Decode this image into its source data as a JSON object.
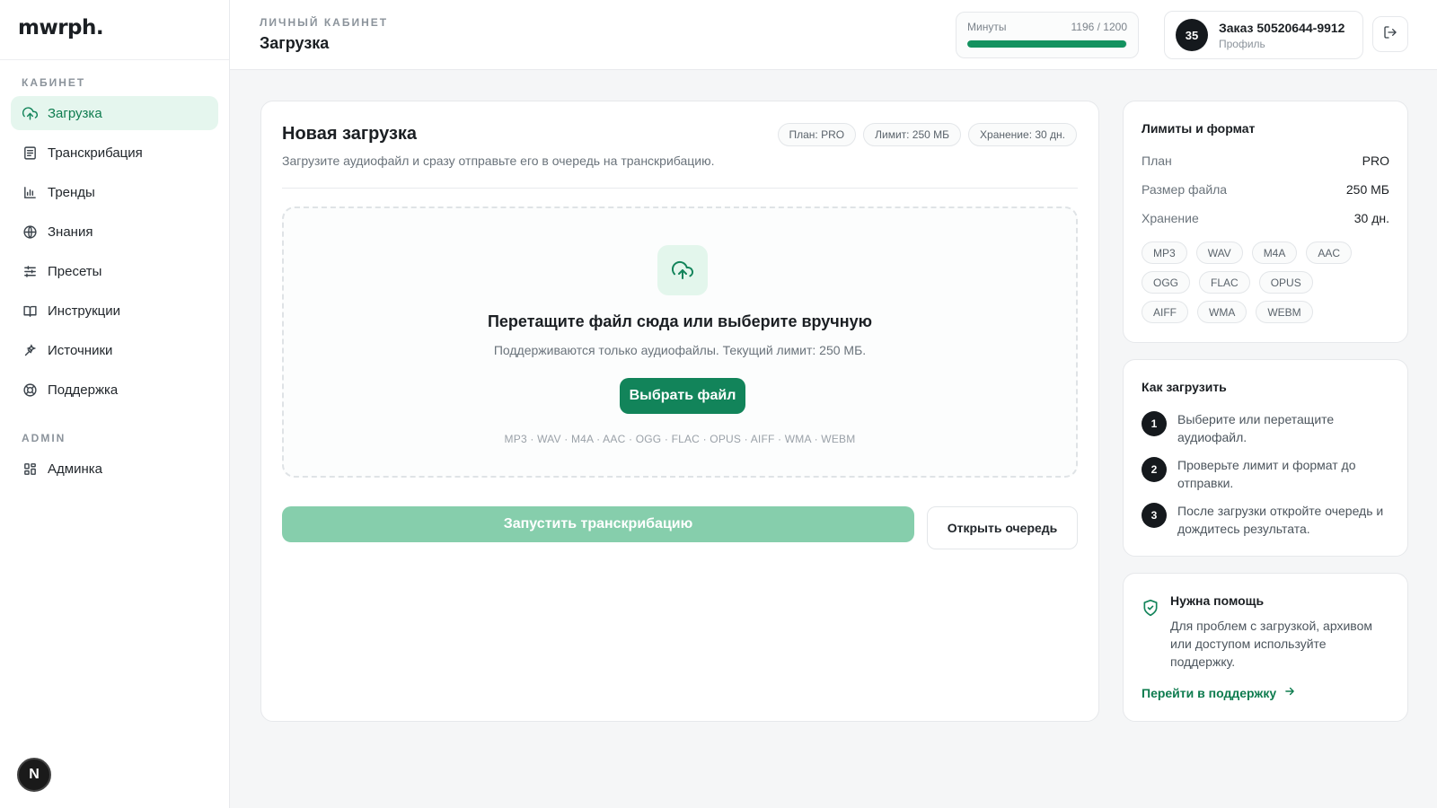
{
  "sidebar": {
    "logo": "mwrph.",
    "section_cabinet": "КАБИНЕТ",
    "section_admin": "ADMIN",
    "items": [
      {
        "label": "Загрузка",
        "icon": "upload-cloud-icon"
      },
      {
        "label": "Транскрибация",
        "icon": "document-icon"
      },
      {
        "label": "Тренды",
        "icon": "bar-chart-icon"
      },
      {
        "label": "Знания",
        "icon": "globe-icon"
      },
      {
        "label": "Пресеты",
        "icon": "sliders-icon"
      },
      {
        "label": "Инструкции",
        "icon": "book-icon"
      },
      {
        "label": "Источники",
        "icon": "sources-icon"
      },
      {
        "label": "Поддержка",
        "icon": "lifebuoy-icon"
      }
    ],
    "admin_item": {
      "label": "Админка",
      "icon": "grid-icon"
    },
    "bottom_badge": "N"
  },
  "header": {
    "crumb": "ЛИЧНЫЙ КАБИНЕТ",
    "title": "Загрузка",
    "minutes_label": "Минуты",
    "minutes_value": "1196 / 1200",
    "minutes_used": 1196,
    "minutes_total": 1200,
    "order_avatar": "35",
    "order_title": "Заказ 50520644-9912",
    "order_sub": "Профиль"
  },
  "upload": {
    "title": "Новая загрузка",
    "subtitle": "Загрузите аудиофайл и сразу отправьте его в очередь на транскрибацию.",
    "pills": [
      "План: PRO",
      "Лимит: 250 МБ",
      "Хранение: 30 дн."
    ],
    "drop_title": "Перетащите файл сюда или выберите вручную",
    "drop_sub": "Поддерживаются только аудиофайлы. Текущий лимит: 250 МБ.",
    "choose_button": "Выбрать файл",
    "formats_line": "MP3 · WAV · M4A · AAC · OGG · FLAC · OPUS · AIFF · WMA · WEBM",
    "start_button": "Запустить транскрибацию",
    "queue_button": "Открыть очередь"
  },
  "limits": {
    "title": "Лимиты и формат",
    "rows": [
      {
        "k": "План",
        "v": "PRO"
      },
      {
        "k": "Размер файла",
        "v": "250 МБ"
      },
      {
        "k": "Хранение",
        "v": "30 дн."
      }
    ],
    "formats": [
      "MP3",
      "WAV",
      "M4A",
      "AAC",
      "OGG",
      "FLAC",
      "OPUS",
      "AIFF",
      "WMA",
      "WEBM"
    ]
  },
  "howto": {
    "title": "Как загрузить",
    "steps": [
      {
        "n": "1",
        "text": "Выберите или перетащите аудиофайл."
      },
      {
        "n": "2",
        "text": "Проверьте лимит и формат до отправки."
      },
      {
        "n": "3",
        "text": "После загрузки откройте очередь и дождитесь результата."
      }
    ]
  },
  "help": {
    "title": "Нужна помощь",
    "text": "Для проблем с загрузкой, архивом или доступом используйте поддержку.",
    "link": "Перейти в поддержку"
  },
  "colors": {
    "accent": "#12845a",
    "accent_light": "#e5f6ee",
    "disabled": "#86ceac"
  }
}
